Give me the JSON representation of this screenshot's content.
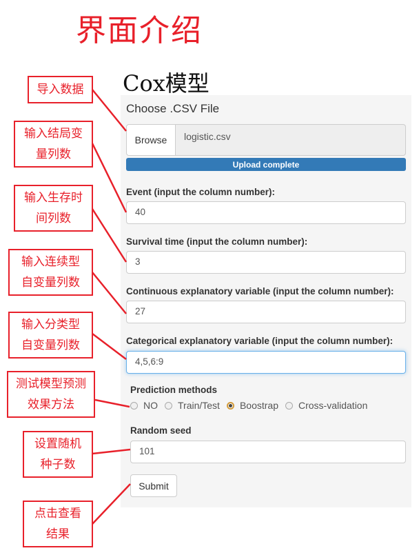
{
  "header": {
    "title": "界面介绍",
    "subtitle": "Cox模型"
  },
  "form": {
    "file_label": "Choose .CSV File",
    "browse_label": "Browse",
    "filename": "logistic.csv",
    "upload_status": "Upload complete",
    "event_label": "Event (input the column number):",
    "event_value": "40",
    "survival_label": "Survival time (input the column number):",
    "survival_value": "3",
    "continuous_label": "Continuous explanatory variable (input the column number):",
    "continuous_value": "27",
    "categorical_label": "Categorical explanatory variable (input the column number):",
    "categorical_value": "4,5,6:9",
    "prediction_label": "Prediction methods",
    "prediction_options": [
      "NO",
      "Train/Test",
      "Boostrap",
      "Cross-validation"
    ],
    "prediction_selected": "Boostrap",
    "seed_label": "Random seed",
    "seed_value": "101",
    "submit_label": "Submit"
  },
  "annotations": [
    {
      "line1": "导入数据",
      "line2": ""
    },
    {
      "line1": "输入结局变",
      "line2": "量列数"
    },
    {
      "line1": "输入生存时",
      "line2": "间列数"
    },
    {
      "line1": "输入连续型",
      "line2": "自变量列数"
    },
    {
      "line1": "输入分类型",
      "line2": "自变量列数"
    },
    {
      "line1": "测试模型预测",
      "line2": "效果方法"
    },
    {
      "line1": "设置随机",
      "line2": "种子数"
    },
    {
      "line1": "点击查看",
      "line2": "结果"
    }
  ],
  "colors": {
    "accent_red": "#e8202a",
    "progress_blue": "#337ab7",
    "panel_bg": "#f5f5f5"
  }
}
